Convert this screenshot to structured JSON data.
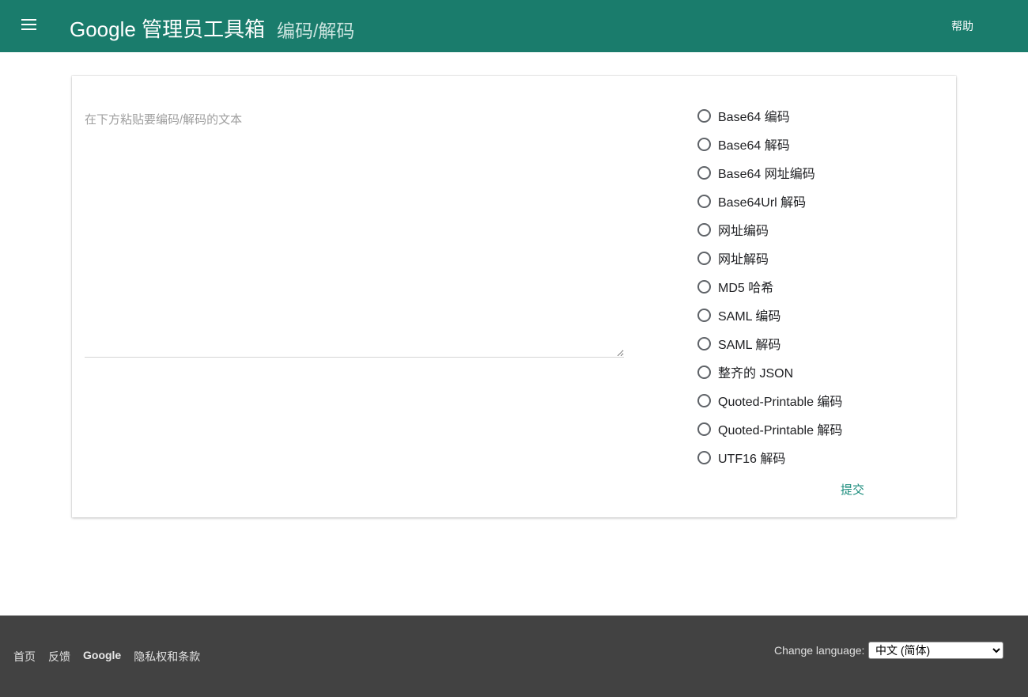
{
  "header": {
    "title": "Google 管理员工具箱",
    "subtitle": "编码/解码",
    "help_label": "帮助"
  },
  "main": {
    "textarea_placeholder": "在下方粘贴要编码/解码的文本",
    "options": [
      {
        "label": "Base64 编码"
      },
      {
        "label": "Base64 解码"
      },
      {
        "label": "Base64 网址编码"
      },
      {
        "label": "Base64Url 解码"
      },
      {
        "label": "网址编码"
      },
      {
        "label": "网址解码"
      },
      {
        "label": "MD5 哈希"
      },
      {
        "label": "SAML 编码"
      },
      {
        "label": "SAML 解码"
      },
      {
        "label": "整齐的 JSON"
      },
      {
        "label": "Quoted-Printable 编码"
      },
      {
        "label": "Quoted-Printable 解码"
      },
      {
        "label": "UTF16 解码"
      }
    ],
    "submit_label": "提交"
  },
  "footer": {
    "links": [
      "首页",
      "反馈",
      "Google",
      "隐私权和条款"
    ],
    "language_label": "Change language:",
    "language_selected": "中文 (简体)"
  },
  "colors": {
    "header_bg": "#1a7c6c",
    "accent": "#1a8c7c",
    "footer_bg": "#424242"
  }
}
